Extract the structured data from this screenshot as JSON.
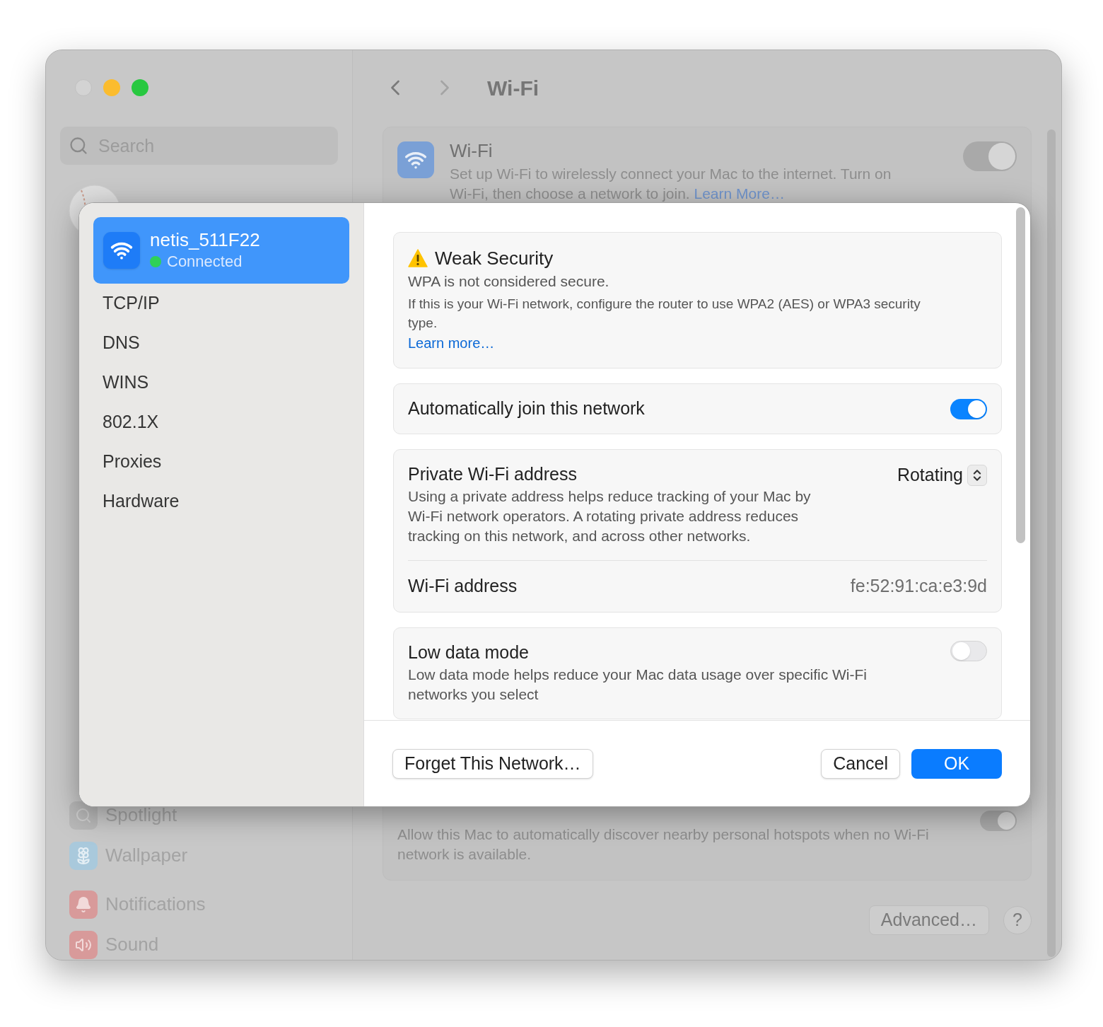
{
  "sidebar": {
    "search": {
      "placeholder": "Search"
    },
    "items": [
      {
        "label": "Spotlight",
        "kind": "spotlight"
      },
      {
        "label": "Wallpaper",
        "kind": "wallpaper"
      },
      {
        "label": "Notifications",
        "kind": "notifications"
      },
      {
        "label": "Sound",
        "kind": "sound"
      }
    ]
  },
  "header": {
    "title": "Wi-Fi"
  },
  "wifi_card": {
    "title": "Wi-Fi",
    "description": "Set up Wi-Fi to wirelessly connect your Mac to the internet. Turn on Wi-Fi, then choose a network to join.",
    "link": "Learn More…",
    "on": true
  },
  "hotspots_card": {
    "description": "Allow this Mac to automatically discover nearby personal hotspots when no Wi-Fi network is available.",
    "on": true
  },
  "footer": {
    "advanced": "Advanced…",
    "help": "?"
  },
  "sheet": {
    "network": {
      "name": "netis_511F22",
      "status": "Connected",
      "selected": true
    },
    "sections": [
      {
        "label": "TCP/IP",
        "selected": false
      },
      {
        "label": "DNS",
        "selected": false
      },
      {
        "label": "WINS",
        "selected": false
      },
      {
        "label": "802.1X",
        "selected": false
      },
      {
        "label": "Proxies",
        "selected": false
      },
      {
        "label": "Hardware",
        "selected": false
      }
    ],
    "weak_security": {
      "title": "Weak Security",
      "subtitle": "WPA is not considered secure.",
      "description": "If this is your Wi-Fi network, configure the router to use WPA2 (AES) or WPA3 security type.",
      "link": "Learn more…"
    },
    "auto_join": {
      "label": "Automatically join this network",
      "on": true
    },
    "private_address": {
      "title": "Private Wi-Fi address",
      "description": "Using a private address helps reduce tracking of your Mac by Wi-Fi network operators. A rotating private address reduces tracking on this network, and across other networks.",
      "value": "Rotating"
    },
    "wifi_address": {
      "label": "Wi-Fi address",
      "value": "fe:52:91:ca:e3:9d"
    },
    "low_data_mode": {
      "title": "Low data mode",
      "description": "Low data mode helps reduce your Mac data usage over specific Wi-Fi networks you select",
      "on": false
    },
    "buttons": [
      {
        "label": "Forget This Network…",
        "kind": "secondary"
      },
      {
        "label": "Cancel",
        "kind": "secondary"
      },
      {
        "label": "OK",
        "kind": "primary"
      }
    ]
  }
}
